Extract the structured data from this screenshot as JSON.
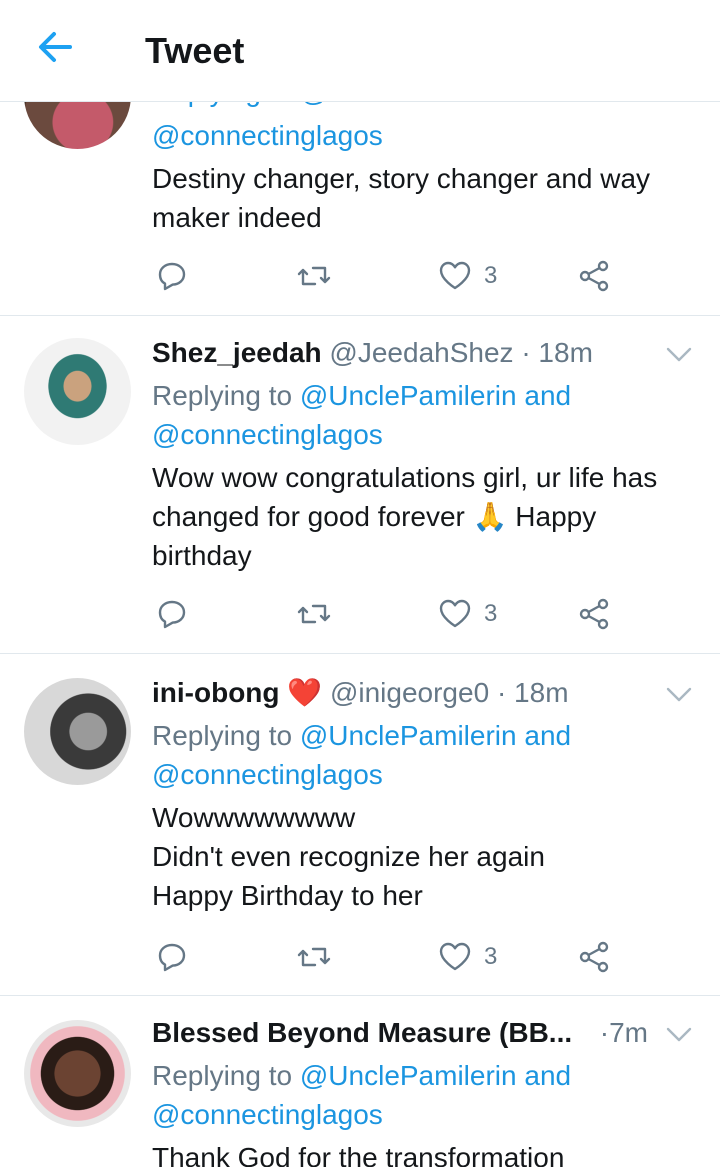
{
  "header": {
    "title": "Tweet"
  },
  "tweets": [
    {
      "name": "",
      "handle": "",
      "time": "",
      "replying_prefix": "",
      "replying_to": "@UnclePamilerin and",
      "mention2": "@connectinglagos",
      "lines": [
        "Destiny changer, story changer and way",
        "maker indeed"
      ],
      "like_count": "3"
    },
    {
      "name": "Shez_jeedah",
      "handle": "@JeedahShez",
      "time": "18m",
      "replying_prefix": "Replying to",
      "replying_to": "@UnclePamilerin and",
      "mention2": "@connectinglagos",
      "lines": [
        "Wow wow congratulations girl, ur life has",
        "changed for good forever 🙏 Happy",
        "birthday"
      ],
      "like_count": "3"
    },
    {
      "name": "ini-obong",
      "name_emoji": "❤️",
      "handle": "@inigeorge0",
      "time": "18m",
      "replying_prefix": "Replying to",
      "replying_to": "@UnclePamilerin and",
      "mention2": "@connectinglagos",
      "lines": [
        "Wowwwwwwww",
        "Didn't even recognize her again",
        "Happy Birthday to her"
      ],
      "like_count": "3"
    },
    {
      "name": "Blessed Beyond Measure (BB...",
      "handle": "",
      "time": "7m",
      "replying_prefix": "Replying to",
      "replying_to": "@UnclePamilerin and",
      "mention2": "@connectinglagos",
      "lines": [
        "Thank God for the transformation"
      ],
      "like_count": ""
    }
  ],
  "dot": "·",
  "colors": {
    "accent": "#1da1f2",
    "link": "#1b95e0",
    "muted": "#657786",
    "heart": "#e0245e"
  }
}
